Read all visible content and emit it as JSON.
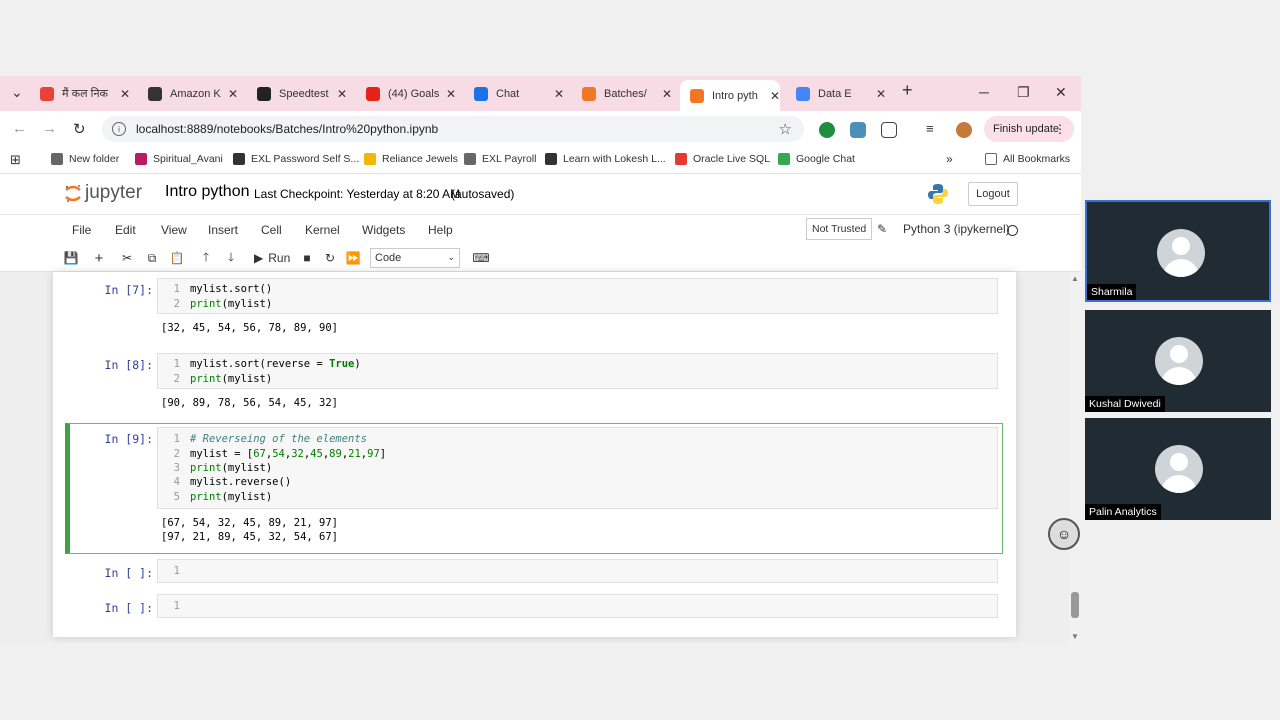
{
  "tabs": [
    {
      "title": "मैं कल निक",
      "color": "#ea4335",
      "icon": "gmail-icon"
    },
    {
      "title": "Amazon K",
      "color": "#333333",
      "icon": "amazon-icon"
    },
    {
      "title": "Speedtest",
      "color": "#222222",
      "icon": "speedtest-icon"
    },
    {
      "title": "(44) Goals",
      "color": "#e62117",
      "icon": "youtube-icon"
    },
    {
      "title": "Chat",
      "color": "#1a73e8",
      "icon": "chat-icon"
    },
    {
      "title": "Batches/",
      "color": "#f37626",
      "icon": "jupyter-icon"
    },
    {
      "title": "Intro pyth",
      "color": "#f37626",
      "icon": "jupyter-icon"
    },
    {
      "title": "Data E",
      "color": "#4285f4",
      "icon": "react-icon"
    }
  ],
  "address": {
    "url": "localhost:8889/notebooks/Batches/Intro%20python.ipynb",
    "finish_update": "Finish update"
  },
  "bookmarks": [
    {
      "label": "New folder",
      "icon": "folder-icon",
      "color": "#666666"
    },
    {
      "label": "Spiritual_Avani",
      "icon": "bookmark-icon",
      "color": "#b71c5f"
    },
    {
      "label": "EXL Password Self S...",
      "icon": "globe-icon",
      "color": "#333333"
    },
    {
      "label": "Reliance Jewels",
      "icon": "reliance-icon",
      "color": "#f2b705"
    },
    {
      "label": "EXL Payroll",
      "icon": "payroll-icon",
      "color": "#666666"
    },
    {
      "label": "Learn with Lokesh L...",
      "icon": "person-icon",
      "color": "#333333"
    },
    {
      "label": "Oracle Live SQL",
      "icon": "oracle-icon",
      "color": "#e53935"
    },
    {
      "label": "Google Chat",
      "icon": "google-chat-icon",
      "color": "#34a853"
    }
  ],
  "all_bookmarks": "All Bookmarks",
  "jupyter": {
    "logo_text": "jupyter",
    "notebook_name": "Intro python",
    "checkpoint": "Last Checkpoint: Yesterday at 8:20 AM",
    "autosave": "(autosaved)",
    "logout": "Logout",
    "menus": [
      "File",
      "Edit",
      "View",
      "Insert",
      "Cell",
      "Kernel",
      "Widgets",
      "Help"
    ],
    "not_trusted": "Not Trusted",
    "kernel": "Python 3 (ipykernel)",
    "run_label": "Run",
    "cell_type": "Code"
  },
  "cells": [
    {
      "prompt": "In [7]:",
      "lines": [
        "mylist.sort()",
        "print(mylist)"
      ],
      "output": "[32, 45, 54, 56, 78, 89, 90]"
    },
    {
      "prompt": "In [8]:",
      "lines": [
        "mylist.sort(reverse = True)",
        "print(mylist)"
      ],
      "output": "[90, 89, 78, 56, 54, 45, 32]"
    },
    {
      "prompt": "In [9]:",
      "lines": [
        "# Reverseing of the elements",
        "mylist = [67,54,32,45,89,21,97]",
        "print(mylist)",
        "mylist.reverse()",
        "print(mylist)"
      ],
      "output": "[67, 54, 32, 45, 89, 21, 97]\n[97, 21, 89, 45, 32, 54, 67]"
    },
    {
      "prompt": "In [ ]:",
      "lines": [
        ""
      ],
      "output": ""
    },
    {
      "prompt": "In [ ]:",
      "lines": [
        ""
      ],
      "output": ""
    }
  ],
  "participants": [
    {
      "name": "Sharmila"
    },
    {
      "name": "Kushal Dwivedi"
    },
    {
      "name": "Palin Analytics"
    }
  ]
}
